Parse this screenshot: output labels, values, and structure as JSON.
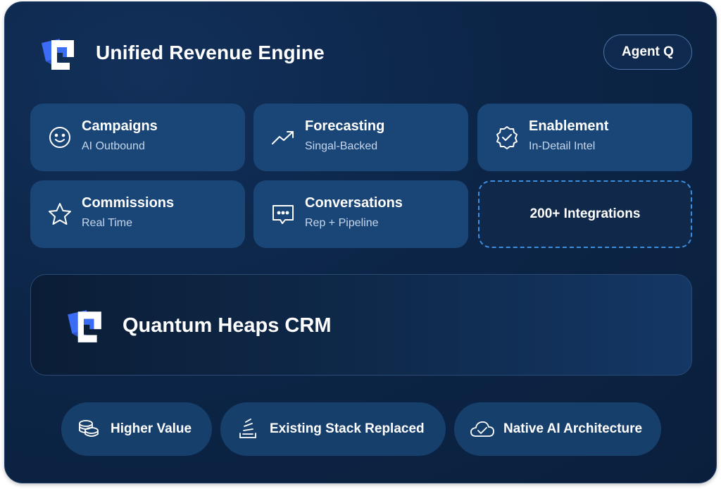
{
  "header": {
    "title": "Unified Revenue Engine",
    "agent_button": "Agent Q"
  },
  "cards": [
    {
      "title": "Campaigns",
      "subtitle": "AI Outbound",
      "icon": "smiley-icon"
    },
    {
      "title": "Forecasting",
      "subtitle": "Singal-Backed",
      "icon": "trend-up-icon"
    },
    {
      "title": "Enablement",
      "subtitle": "In-Detail Intel",
      "icon": "verified-badge-icon"
    },
    {
      "title": "Commissions",
      "subtitle": "Real Time",
      "icon": "star-icon"
    },
    {
      "title": "Conversations",
      "subtitle": "Rep + Pipeline",
      "icon": "chat-bubble-icon"
    }
  ],
  "integrations": "200+ Integrations",
  "crm": {
    "title": "Quantum Heaps CRM"
  },
  "pills": [
    {
      "label": "Higher Value",
      "icon": "coins-icon"
    },
    {
      "label": "Existing Stack Replaced",
      "icon": "stack-icon"
    },
    {
      "label": "Native AI Architecture",
      "icon": "cloud-check-icon"
    }
  ],
  "colors": {
    "background": "#0c2547",
    "card": "#1a4677",
    "accent_blue": "#3b6cf6",
    "dashed_border": "#3b8ee0"
  }
}
